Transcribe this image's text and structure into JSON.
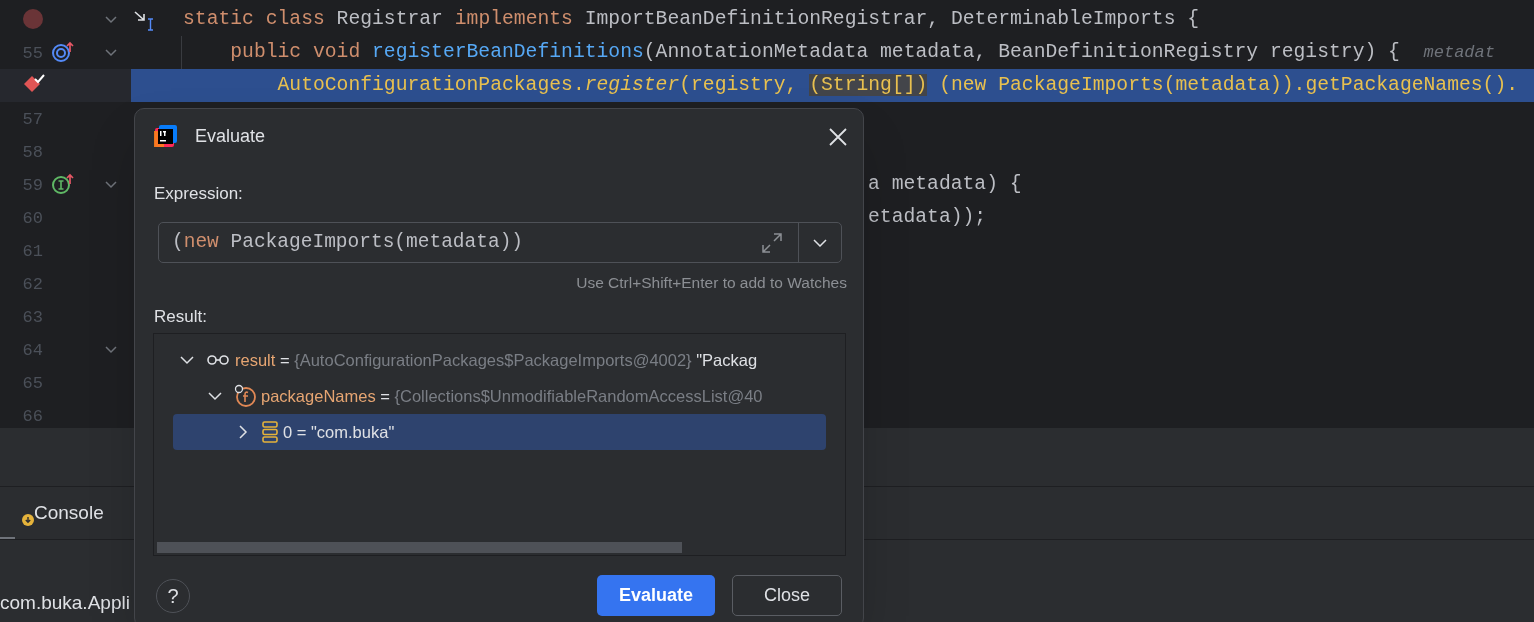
{
  "editor": {
    "lines": [
      {
        "kind": "muted",
        "foldable": true,
        "current": false,
        "segments": [
          {
            "text": "static class ",
            "kind": "keyword"
          },
          {
            "text": "Registrar ",
            "kind": "plain"
          },
          {
            "text": "implements ",
            "kind": "keyword"
          },
          {
            "text": "ImportBeanDefinitionRegistrar, DeterminableImports {",
            "kind": "plain"
          }
        ]
      },
      {
        "number": "55",
        "kind": "implemented",
        "foldable": true,
        "current": false,
        "segments": [
          {
            "text": "    public void ",
            "kind": "keyword"
          },
          {
            "text": "registerBeanDefinitions",
            "kind": "method"
          },
          {
            "text": "(AnnotationMetadata metadata, BeanDefinitionRegistry registry) {  ",
            "kind": "plain"
          },
          {
            "text": "metadat",
            "kind": "hint"
          }
        ]
      },
      {
        "kind": "breakpoint",
        "foldable": false,
        "current": true,
        "segments": [
          {
            "text": "        AutoConfigurationPackages.",
            "kind": "plain"
          },
          {
            "text": "register",
            "kind": "static-call"
          },
          {
            "text": "(registry, ",
            "kind": "plain"
          },
          {
            "text": "(String[])",
            "kind": "brace-match"
          },
          {
            "text": " (new PackageImports(metadata)).getPackageNames().",
            "kind": "plain"
          }
        ]
      },
      {
        "number": "57",
        "foldable": false,
        "current": false
      },
      {
        "number": "58",
        "foldable": false,
        "current": false
      },
      {
        "number": "59",
        "kind": "implements",
        "foldable": true,
        "current": false,
        "segments": [
          {
            "text": "a metadata) {",
            "kind": "covered"
          }
        ]
      },
      {
        "number": "60",
        "foldable": false,
        "current": false,
        "segments": [
          {
            "text": "etadata));",
            "kind": "covered"
          }
        ]
      },
      {
        "number": "61",
        "foldable": false,
        "current": false
      },
      {
        "number": "62",
        "foldable": false,
        "current": false
      },
      {
        "number": "63",
        "foldable": false,
        "current": false
      },
      {
        "number": "64",
        "foldable": true,
        "current": false
      },
      {
        "number": "65",
        "foldable": false,
        "current": false
      },
      {
        "number": "66",
        "foldable": false,
        "current": false
      }
    ]
  },
  "bottom_panel": {
    "tab": "Console",
    "console_text": "com.buka.Appli"
  },
  "dialog": {
    "title": "Evaluate",
    "expression_label": "Expression:",
    "expression": [
      {
        "text": "(",
        "kind": "plain"
      },
      {
        "text": "new ",
        "kind": "keyword"
      },
      {
        "text": "PackageImports(metadata))",
        "kind": "plain"
      }
    ],
    "hint": "Use Ctrl+Shift+Enter to add to Watches",
    "result_label": "Result:",
    "tree": [
      {
        "kind": "watch",
        "name": "result",
        "operator": "=",
        "type": "{AutoConfigurationPackages$PackageImports@4002}",
        "value": "\"Packag",
        "expanded": true,
        "selected": false,
        "children": [
          {
            "kind": "field",
            "name": "packageNames",
            "operator": "=",
            "type": "{Collections$UnmodifiableRandomAccessList@40",
            "expanded": true,
            "selected": false,
            "children": [
              {
                "kind": "element",
                "name": "0",
                "operator": "=",
                "value": "\"com.buka\"",
                "expanded": false,
                "selected": true
              }
            ]
          }
        ]
      }
    ],
    "help_button": "?",
    "buttons": [
      {
        "label": "Evaluate",
        "primary": true
      },
      {
        "label": "Close",
        "primary": false
      }
    ]
  }
}
